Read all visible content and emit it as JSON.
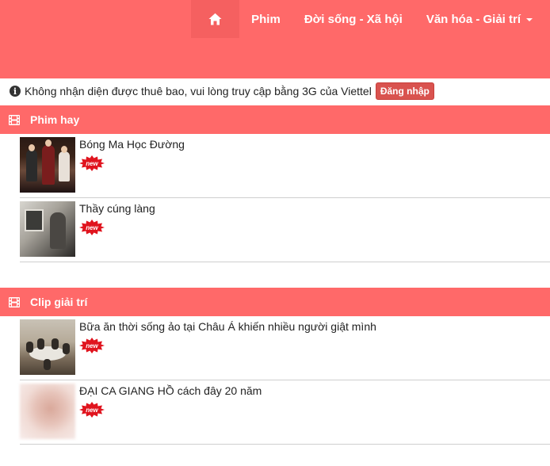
{
  "nav": {
    "home_icon": "home-icon",
    "items": [
      "Phim",
      "Đời sống - Xã hội",
      "Văn hóa - Giải trí"
    ]
  },
  "notice": {
    "text": "Không nhận diện được thuê bao, vui lòng truy cập bằng 3G của Viettel",
    "login_label": "Đăng nhập"
  },
  "sections": [
    {
      "title": "Phim hay",
      "icon": "film-icon",
      "items": [
        {
          "title": "Bóng Ma Học Đường",
          "badge": "new"
        },
        {
          "title": "Thầy cúng làng",
          "badge": "new"
        }
      ]
    },
    {
      "title": "Clip giải trí",
      "icon": "film-icon",
      "items": [
        {
          "title": "Bữa ăn thời sống ảo tại Châu Á khiến nhiều người giật mình",
          "badge": "new"
        },
        {
          "title": "ĐẠI CA GIANG HỒ cách đây 20 năm",
          "badge": "new"
        }
      ]
    }
  ],
  "colors": {
    "brand": "#ff6969",
    "login_button": "#d9534f",
    "badge_red": "#e0141e"
  }
}
